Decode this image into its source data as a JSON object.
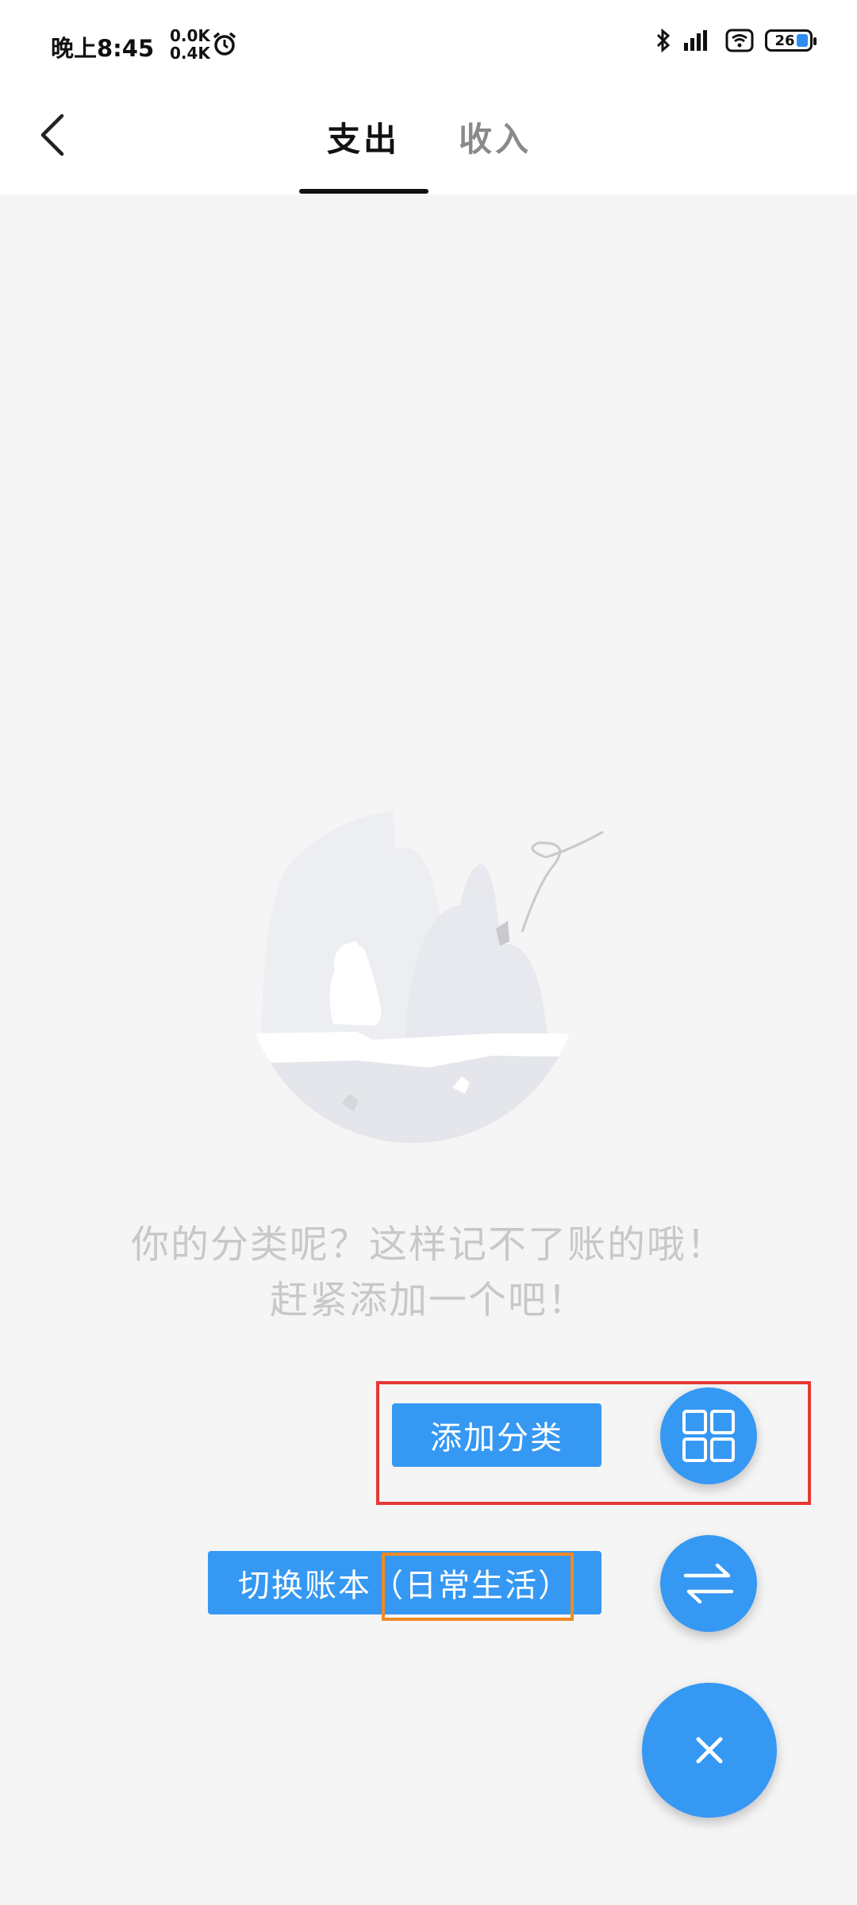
{
  "status_bar": {
    "time": "晚上8:45",
    "net_up": "0.0K",
    "net_down": "0.4K",
    "battery": "26"
  },
  "header": {
    "tabs": [
      {
        "label": "支出",
        "active": true
      },
      {
        "label": "收入",
        "active": false
      }
    ]
  },
  "empty_state": {
    "line1": "你的分类呢？这样记不了账的哦！",
    "line2": "赶紧添加一个吧！"
  },
  "actions": {
    "add_category": "添加分类",
    "switch_book_prefix": "切换账本",
    "switch_book_name": "（日常生活）"
  },
  "colors": {
    "accent": "#3598f3",
    "highlight_red": "#e53935",
    "highlight_orange": "#f08a24"
  },
  "icons": [
    "back-arrow-icon",
    "grid-icon",
    "swap-arrows-icon",
    "close-icon",
    "alarm-icon",
    "bluetooth-icon",
    "signal-icon",
    "wifi-icon",
    "battery-icon"
  ]
}
